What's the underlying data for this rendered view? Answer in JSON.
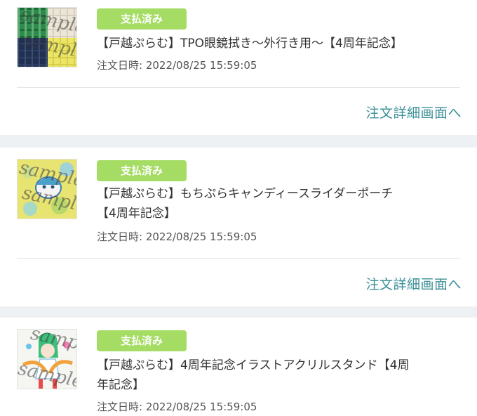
{
  "orders": [
    {
      "status": "支払済み",
      "title": "【戸越ぷらむ】TPO眼鏡拭き〜外行き用〜【4周年記念】",
      "date": "注文日時: 2022/08/25 15:59:05",
      "link": "注文詳細画面へ",
      "watermark": "sample"
    },
    {
      "status": "支払済み",
      "title_line1": "【戸越ぷらむ】もちぷらキャンディースライダーポーチ",
      "title_line2": "【4周年記念】",
      "date": "注文日時: 2022/08/25 15:59:05",
      "link": "注文詳細画面へ",
      "watermark": "sample"
    },
    {
      "status": "支払済み",
      "title_line1": "【戸越ぷらむ】4周年記念イラストアクリルスタンド【4周",
      "title_line2": "年記念】",
      "date": "注文日時: 2022/08/25 15:59:05",
      "watermark": "sample"
    }
  ]
}
